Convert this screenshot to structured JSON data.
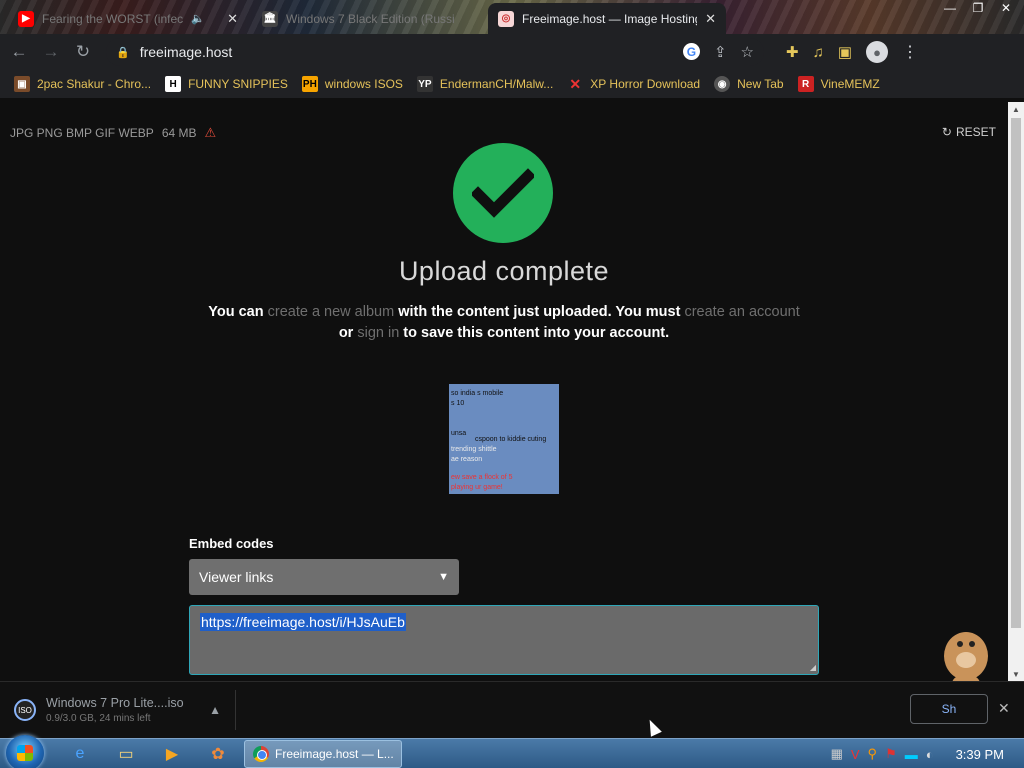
{
  "tabs": [
    {
      "title": "Fearing the WORST (infec",
      "icon": "youtube-icon"
    },
    {
      "title": "Windows 7 Black Edition (Russi",
      "icon": "archive-icon"
    },
    {
      "title": "Freeimage.host — Image Hosting",
      "icon": "freeimage-icon",
      "active": true
    }
  ],
  "address_bar": {
    "url": "freeimage.host"
  },
  "bookmarks": [
    {
      "label": "2pac Shakur - Chro...",
      "icon": "bookmark-image-icon"
    },
    {
      "label": "FUNNY SNIPPIES",
      "icon": "h-icon"
    },
    {
      "label": "windows ISOS",
      "icon": "ph-icon"
    },
    {
      "label": "EndermanCH/Malw...",
      "icon": "yp-icon"
    },
    {
      "label": "XP Horror Download",
      "icon": "x-icon"
    },
    {
      "label": "New Tab",
      "icon": "newtab-icon"
    },
    {
      "label": "VineMEMZ",
      "icon": "r-icon"
    }
  ],
  "page": {
    "formats": "JPG PNG BMP GIF WEBP",
    "max_size": "64 MB",
    "reset_label": "RESET",
    "heading": "Upload complete",
    "message": {
      "p1": "You can",
      "link1": "create a new album",
      "p2": "with the content just uploaded. You must",
      "link2": "create an account",
      "p3": "or",
      "link3": "sign in",
      "p4": "to save this content into your account."
    },
    "thumbnail_lines": [
      "so india s mobile",
      "s 10",
      "unsa",
      "cspoon to kiddie cuting",
      "trending shittle",
      "ae reason",
      "ew save a flock of 5",
      "playing ur game!"
    ],
    "embed_codes_label": "Embed codes",
    "embed_select": {
      "value": "Viewer links"
    },
    "embed_value": "https://freeimage.host/i/HJsAuEb"
  },
  "download_shelf": {
    "file": "Windows 7 Pro Lite....iso",
    "status": "0.9/3.0 GB, 24 mins left",
    "show_all_label": "Sh"
  },
  "taskbar": {
    "chrome_label": "Freeimage.host — L...",
    "time": "3:39 PM"
  },
  "colors": {
    "success": "#23b05a",
    "accent_outline": "#2fa7b8",
    "selection": "#1f5fc9"
  }
}
